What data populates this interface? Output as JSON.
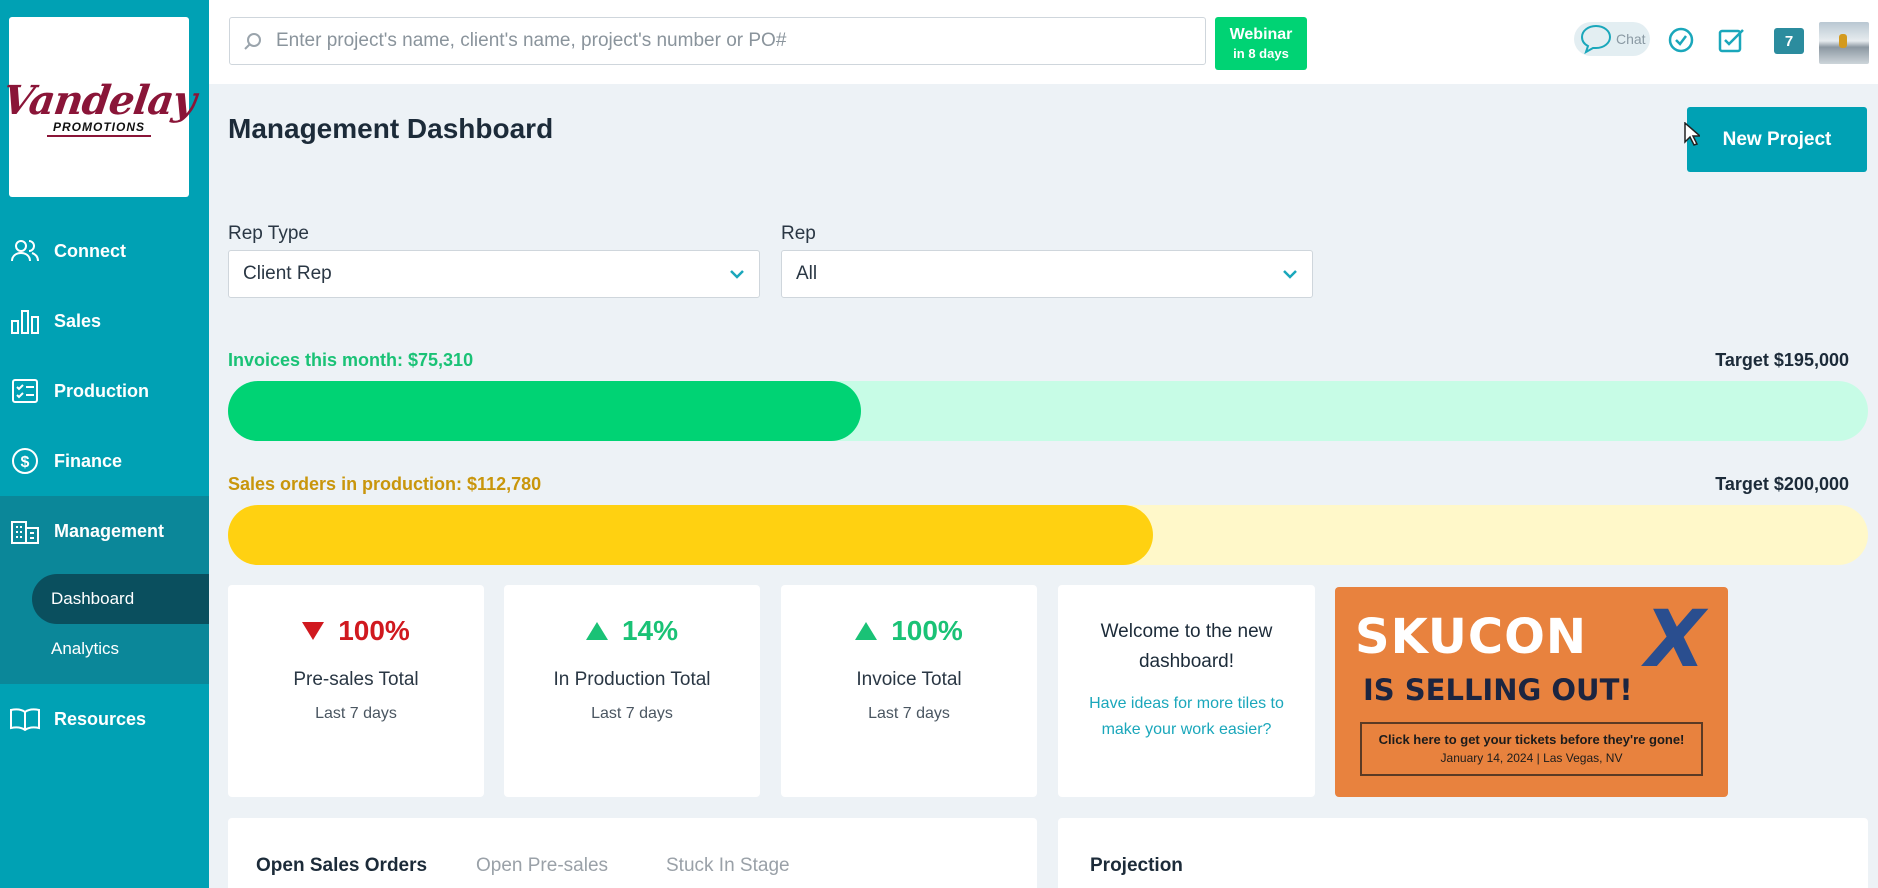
{
  "brand": {
    "logo_script": "Vandelay",
    "logo_sub": "PROMOTIONS",
    "color": "#8a1538"
  },
  "sidebar": {
    "items": [
      {
        "label": "Connect",
        "icon": "users-icon"
      },
      {
        "label": "Sales",
        "icon": "bar-chart-icon"
      },
      {
        "label": "Production",
        "icon": "checklist-icon"
      },
      {
        "label": "Finance",
        "icon": "dollar-icon"
      },
      {
        "label": "Management",
        "icon": "building-icon"
      },
      {
        "label": "Resources",
        "icon": "book-icon"
      }
    ],
    "sub_items": [
      {
        "label": "Dashboard"
      },
      {
        "label": "Analytics"
      }
    ]
  },
  "topbar": {
    "search_placeholder": "Enter project's name, client's name, project's number or PO#",
    "webinar_title": "Webinar",
    "webinar_sub": "in 8 days",
    "chat_label": "Chat",
    "notification_count": "7"
  },
  "main": {
    "title": "Management Dashboard",
    "new_project_label": "New Project",
    "filters": {
      "rep_type_label": "Rep Type",
      "rep_type_value": "Client Rep",
      "rep_label": "Rep",
      "rep_value": "All"
    },
    "progress": [
      {
        "label": "Invoices this month: $75,310",
        "target": "Target $195,000",
        "fraction": 0.386,
        "fill": "#00d374",
        "track": "#c7fce6",
        "label_color": "#1ac276"
      },
      {
        "label": "Sales orders in production: $112,780",
        "target": "Target $200,000",
        "fraction": 0.564,
        "fill": "#ffd111",
        "track": "#fff8c9",
        "label_color": "#c9960c"
      }
    ],
    "tiles": [
      {
        "pct": "100%",
        "direction": "down",
        "name": "Pre-sales Total",
        "period": "Last 7 days",
        "color": "#d0191f"
      },
      {
        "pct": "14%",
        "direction": "up",
        "name": "In Production Total",
        "period": "Last 7 days",
        "color": "#1ac276"
      },
      {
        "pct": "100%",
        "direction": "up",
        "name": "Invoice Total",
        "period": "Last 7 days",
        "color": "#1ac276"
      }
    ],
    "welcome": {
      "title": "Welcome to the new dashboard!",
      "link": "Have ideas for more tiles to make your work easier?"
    },
    "ad": {
      "line1": "SKUCON",
      "x": "X",
      "line2": "IS SELLING OUT!",
      "cta": "Click here to get your tickets before they're gone!",
      "details": "January 14, 2024 | Las Vegas, NV"
    },
    "tabs": [
      "Open Sales Orders",
      "Open Pre-sales",
      "Stuck In Stage"
    ],
    "projection_title": "Projection"
  }
}
